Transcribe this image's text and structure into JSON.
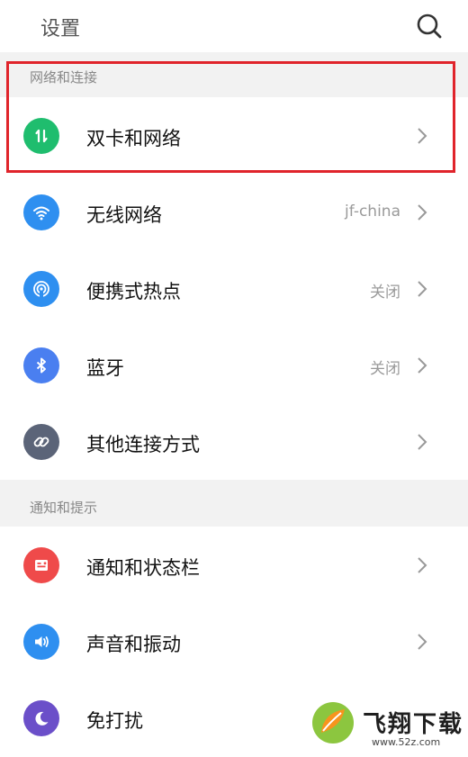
{
  "header": {
    "title": "设置"
  },
  "sections": [
    {
      "title": "网络和连接",
      "items": [
        {
          "label": "双卡和网络",
          "value": "",
          "icon": "dual-sim-icon",
          "color": "#1fbd6e"
        },
        {
          "label": "无线网络",
          "value": "jf-china",
          "icon": "wifi-icon",
          "color": "#2e8ff0"
        },
        {
          "label": "便携式热点",
          "value": "关闭",
          "icon": "hotspot-icon",
          "color": "#2e8ff0"
        },
        {
          "label": "蓝牙",
          "value": "关闭",
          "icon": "bluetooth-icon",
          "color": "#4a7ff0"
        },
        {
          "label": "其他连接方式",
          "value": "",
          "icon": "link-icon",
          "color": "#5b6478"
        }
      ]
    },
    {
      "title": "通知和提示",
      "items": [
        {
          "label": "通知和状态栏",
          "value": "",
          "icon": "notification-icon",
          "color": "#ef4a4a"
        },
        {
          "label": "声音和振动",
          "value": "",
          "icon": "sound-icon",
          "color": "#2e8ff0"
        },
        {
          "label": "免打扰",
          "value": "",
          "icon": "moon-icon",
          "color": "#6b4fc9"
        }
      ]
    }
  ],
  "watermark": {
    "name": "飞翔下载",
    "url": "www.52z.com"
  },
  "colors": {
    "highlight": "#e0242b",
    "section_bg": "#f2f2f2"
  }
}
